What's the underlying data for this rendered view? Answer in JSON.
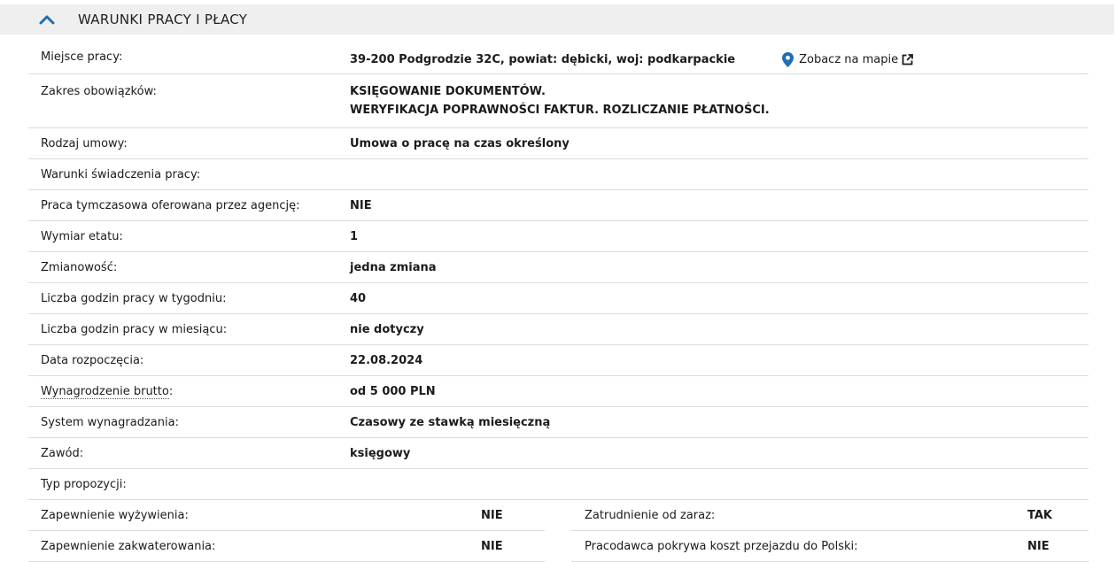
{
  "section": {
    "title": "WARUNKI PRACY I PŁACY",
    "collapse_icon": "chevron-up-icon",
    "accent_color": "#1e6fb3"
  },
  "details": {
    "location": {
      "label": "Miejsce pracy:",
      "value": "39-200 Podgrodzie 32C, powiat: dębicki, woj: podkarpackie",
      "map_link": "Zobacz na mapie",
      "pin_icon": "map-pin-icon",
      "external_icon": "external-link-icon"
    },
    "duties": {
      "label": "Zakres obowiązków:",
      "line1": "KSIĘGOWANIE DOKUMENTÓW.",
      "line2": "WERYFIKACJA POPRAWNOŚCI FAKTUR. ROZLICZANIE PŁATNOŚCI."
    },
    "contract_type": {
      "label": "Rodzaj umowy:",
      "value": "Umowa o pracę na czas określony"
    },
    "work_conditions": {
      "label": "Warunki świadczenia pracy:",
      "value": ""
    },
    "temp_agency": {
      "label": "Praca tymczasowa oferowana przez agencję:",
      "value": "NIE"
    },
    "fte": {
      "label": "Wymiar etatu:",
      "value": "1"
    },
    "shifts": {
      "label": "Zmianowość:",
      "value": "jedna zmiana"
    },
    "hours_week": {
      "label": "Liczba godzin pracy w tygodniu:",
      "value": "40"
    },
    "hours_month": {
      "label": "Liczba godzin pracy w miesiącu:",
      "value": "nie dotyczy"
    },
    "start_date": {
      "label": "Data rozpoczęcia:",
      "value": "22.08.2024"
    },
    "salary": {
      "label": "Wynagrodzenie brutto:",
      "label_underlined": "Wynagrodzenie brutto",
      "value": "od 5 000 PLN"
    },
    "pay_system": {
      "label": "System wynagradzania:",
      "value": "Czasowy ze stawką miesięczną"
    },
    "occupation": {
      "label": "Zawód:",
      "value": "księgowy"
    },
    "offer_type": {
      "label": "Typ propozycji:",
      "value": ""
    }
  },
  "extras": {
    "meals": {
      "label": "Zapewnienie wyżywienia:",
      "value": "NIE"
    },
    "immediate": {
      "label": "Zatrudnienie od zaraz:",
      "value": "TAK"
    },
    "housing": {
      "label": "Zapewnienie zakwaterowania:",
      "value": "NIE"
    },
    "travel": {
      "label": "Pracodawca pokrywa koszt przejazdu do Polski:",
      "value": "NIE"
    }
  }
}
